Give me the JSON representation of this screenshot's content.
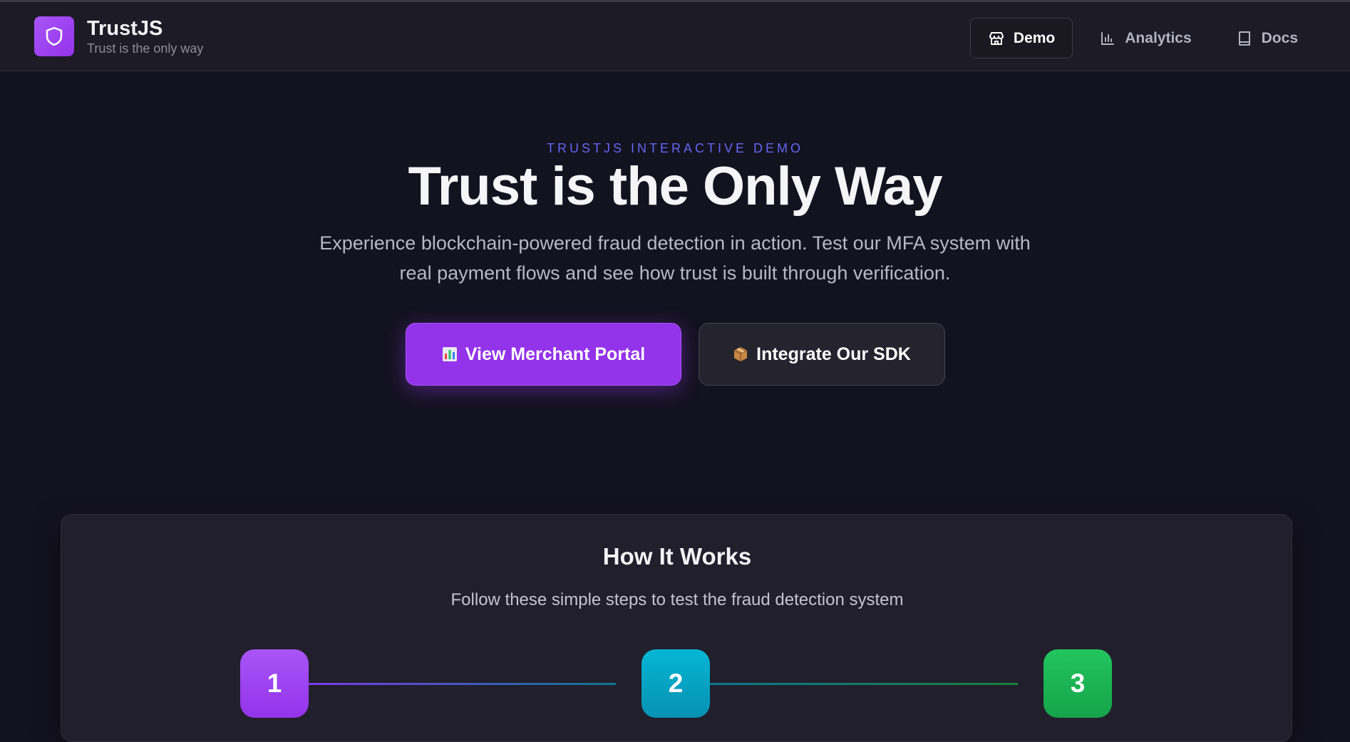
{
  "header": {
    "brand_name": "TrustJS",
    "brand_tagline": "Trust is the only way",
    "brand_icon": "shield-icon",
    "nav": [
      {
        "label": "Demo",
        "icon": "store-icon",
        "active": true
      },
      {
        "label": "Analytics",
        "icon": "bar-chart-icon",
        "active": false
      },
      {
        "label": "Docs",
        "icon": "book-icon",
        "active": false
      }
    ]
  },
  "hero": {
    "eyebrow": "TRUSTJS INTERACTIVE DEMO",
    "title": "Trust is the Only Way",
    "subtitle": "Experience blockchain-powered fraud detection in action. Test our MFA system with real payment flows and see how trust is built through verification.",
    "primary_cta": {
      "emoji": "📊",
      "label": "View Merchant Portal"
    },
    "secondary_cta": {
      "emoji": "📦",
      "label": "Integrate Our SDK"
    }
  },
  "how_it_works": {
    "title": "How It Works",
    "subtitle": "Follow these simple steps to test the fraud detection system",
    "steps": [
      {
        "number": "1",
        "color": "#9333ea"
      },
      {
        "number": "2",
        "color": "#06b6d4"
      },
      {
        "number": "3",
        "color": "#22c55e"
      }
    ]
  },
  "colors": {
    "accent": "#9333ea",
    "eyebrow": "#6366f1",
    "background": "#13121f",
    "header_bg": "#1c1b26"
  }
}
